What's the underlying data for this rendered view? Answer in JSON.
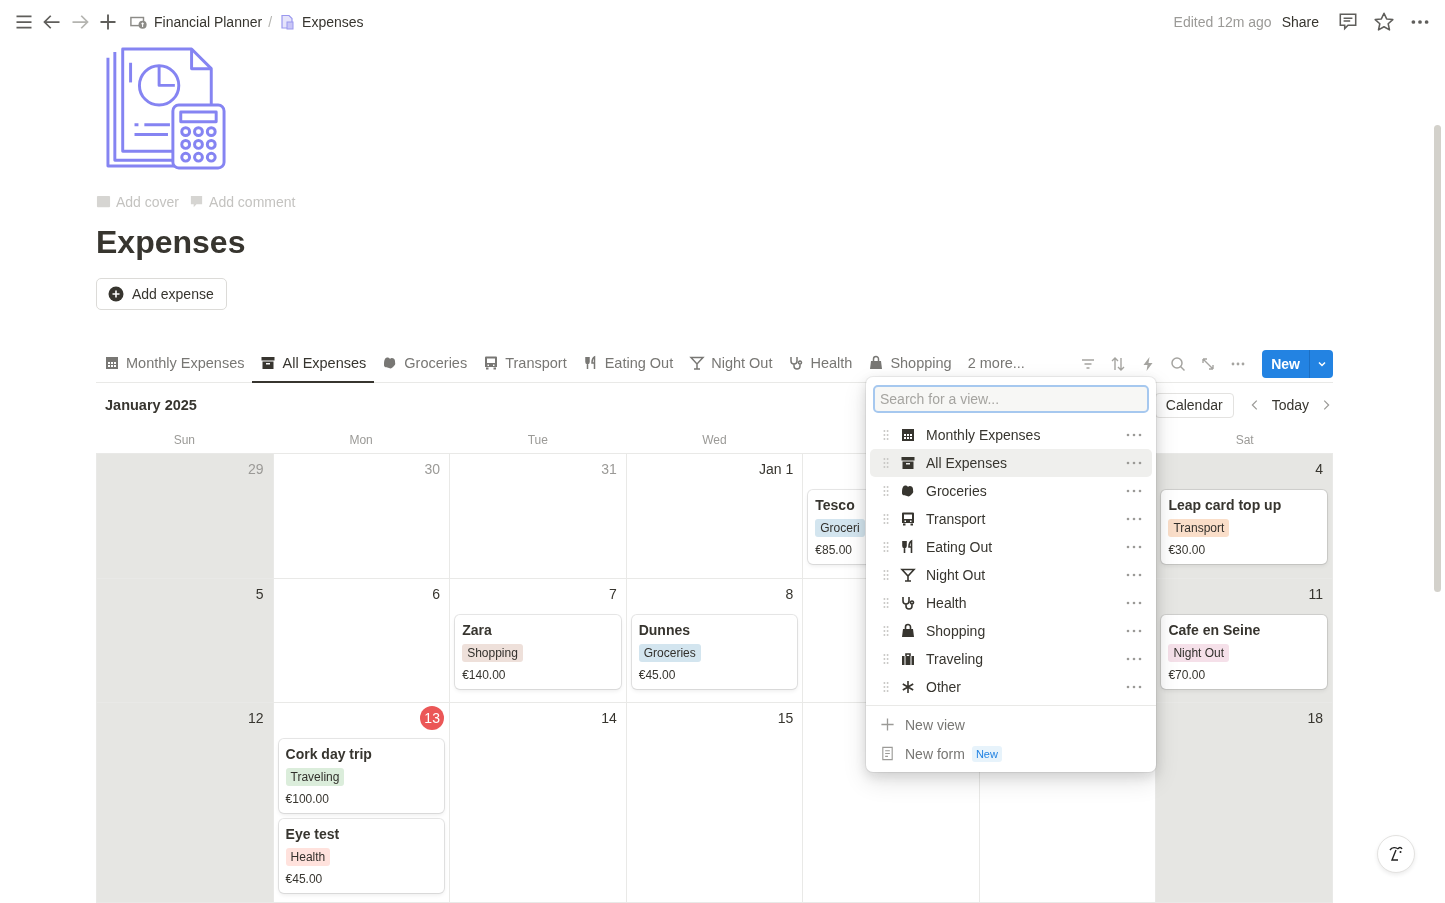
{
  "topbar": {
    "breadcrumbs": [
      {
        "label": "Financial Planner"
      },
      {
        "label": "Expenses"
      }
    ],
    "separator": "/",
    "edited": "Edited 12m ago",
    "share": "Share"
  },
  "page": {
    "add_cover": "Add cover",
    "add_comment": "Add comment",
    "title": "Expenses",
    "add_button": "Add expense"
  },
  "views": {
    "tabs": [
      {
        "label": "Monthly Expenses",
        "selected": false
      },
      {
        "label": "All Expenses",
        "selected": true
      },
      {
        "label": "Groceries",
        "selected": false
      },
      {
        "label": "Transport",
        "selected": false
      },
      {
        "label": "Eating Out",
        "selected": false
      },
      {
        "label": "Night Out",
        "selected": false
      },
      {
        "label": "Health",
        "selected": false
      },
      {
        "label": "Shopping",
        "selected": false
      }
    ],
    "more": "2 more...",
    "new_button": "New"
  },
  "calendar": {
    "month": "January 2025",
    "view_button": "Calendar",
    "today_button": "Today",
    "weekdays": [
      "Sun",
      "Mon",
      "Tue",
      "Wed",
      "Sat"
    ],
    "weeks": [
      {
        "days": [
          {
            "date": {
              "label": "29",
              "muted": true,
              "today": false
            },
            "weekend": true
          },
          {
            "date": {
              "label": "30",
              "muted": true,
              "today": false
            },
            "weekend": false
          },
          {
            "date": {
              "label": "31",
              "muted": true,
              "today": false
            },
            "weekend": false
          },
          {
            "date": {
              "label": "Jan 1",
              "muted": false,
              "today": false
            },
            "weekend": false
          },
          {
            "weekend": false,
            "events": [
              {
                "title": "Tesco",
                "tag": {
                  "label": "Groceri",
                  "color": "#d3e5ef"
                },
                "amount": "€85.00"
              }
            ]
          },
          {
            "date": {
              "label": "4",
              "muted": false,
              "today": false
            },
            "weekend": true,
            "events": [
              {
                "title": "Leap card top up",
                "tag": {
                  "label": "Transport",
                  "color": "#fadec9"
                },
                "amount": "€30.00"
              }
            ]
          }
        ]
      },
      {
        "days": [
          {
            "date": {
              "label": "5",
              "muted": false,
              "today": false
            },
            "weekend": true
          },
          {
            "date": {
              "label": "6",
              "muted": false,
              "today": false
            },
            "weekend": false
          },
          {
            "date": {
              "label": "7",
              "muted": false,
              "today": false
            },
            "weekend": false,
            "events": [
              {
                "title": "Zara",
                "tag": {
                  "label": "Shopping",
                  "color": "#eee0da"
                },
                "amount": "€140.00"
              }
            ]
          },
          {
            "date": {
              "label": "8",
              "muted": false,
              "today": false
            },
            "weekend": false,
            "events": [
              {
                "title": "Dunnes",
                "tag": {
                  "label": "Groceries",
                  "color": "#d3e5ef"
                },
                "amount": "€45.00"
              }
            ]
          },
          {
            "weekend": false
          },
          {
            "date": {
              "label": "11",
              "muted": false,
              "today": false
            },
            "weekend": true,
            "events": [
              {
                "title": "Cafe en Seine",
                "tag": {
                  "label": "Night Out",
                  "color": "#f5e0e9"
                },
                "amount": "€70.00"
              }
            ]
          }
        ]
      },
      {
        "days": [
          {
            "date": {
              "label": "12",
              "muted": false,
              "today": false
            },
            "weekend": true
          },
          {
            "date": {
              "label": "13",
              "muted": false,
              "today": true
            },
            "weekend": false,
            "events": [
              {
                "title": "Cork day trip",
                "tag": {
                  "label": "Traveling",
                  "color": "#dbeddb"
                },
                "amount": "€100.00"
              },
              {
                "title": "Eye test",
                "tag": {
                  "label": "Health",
                  "color": "#ffe2dd"
                },
                "amount": "€45.00"
              }
            ]
          },
          {
            "date": {
              "label": "14",
              "muted": false,
              "today": false
            },
            "weekend": false
          },
          {
            "date": {
              "label": "15",
              "muted": false,
              "today": false
            },
            "weekend": false
          },
          {
            "weekend": false
          },
          {
            "weekend": false
          },
          {
            "date": {
              "label": "18",
              "muted": false,
              "today": false
            },
            "weekend": true
          }
        ]
      }
    ]
  },
  "view_menu": {
    "search": {
      "placeholder": "Search for a view..."
    },
    "items": [
      {
        "label": "Monthly Expenses",
        "selected": false
      },
      {
        "label": "All Expenses",
        "selected": true
      },
      {
        "label": "Groceries",
        "selected": false
      },
      {
        "label": "Transport",
        "selected": false
      },
      {
        "label": "Eating Out",
        "selected": false
      },
      {
        "label": "Night Out",
        "selected": false
      },
      {
        "label": "Health",
        "selected": false
      },
      {
        "label": "Shopping",
        "selected": false
      },
      {
        "label": "Traveling",
        "selected": false
      },
      {
        "label": "Other",
        "selected": false
      }
    ],
    "new_view": "New view",
    "new_form": "New form",
    "new_badge": "New"
  }
}
